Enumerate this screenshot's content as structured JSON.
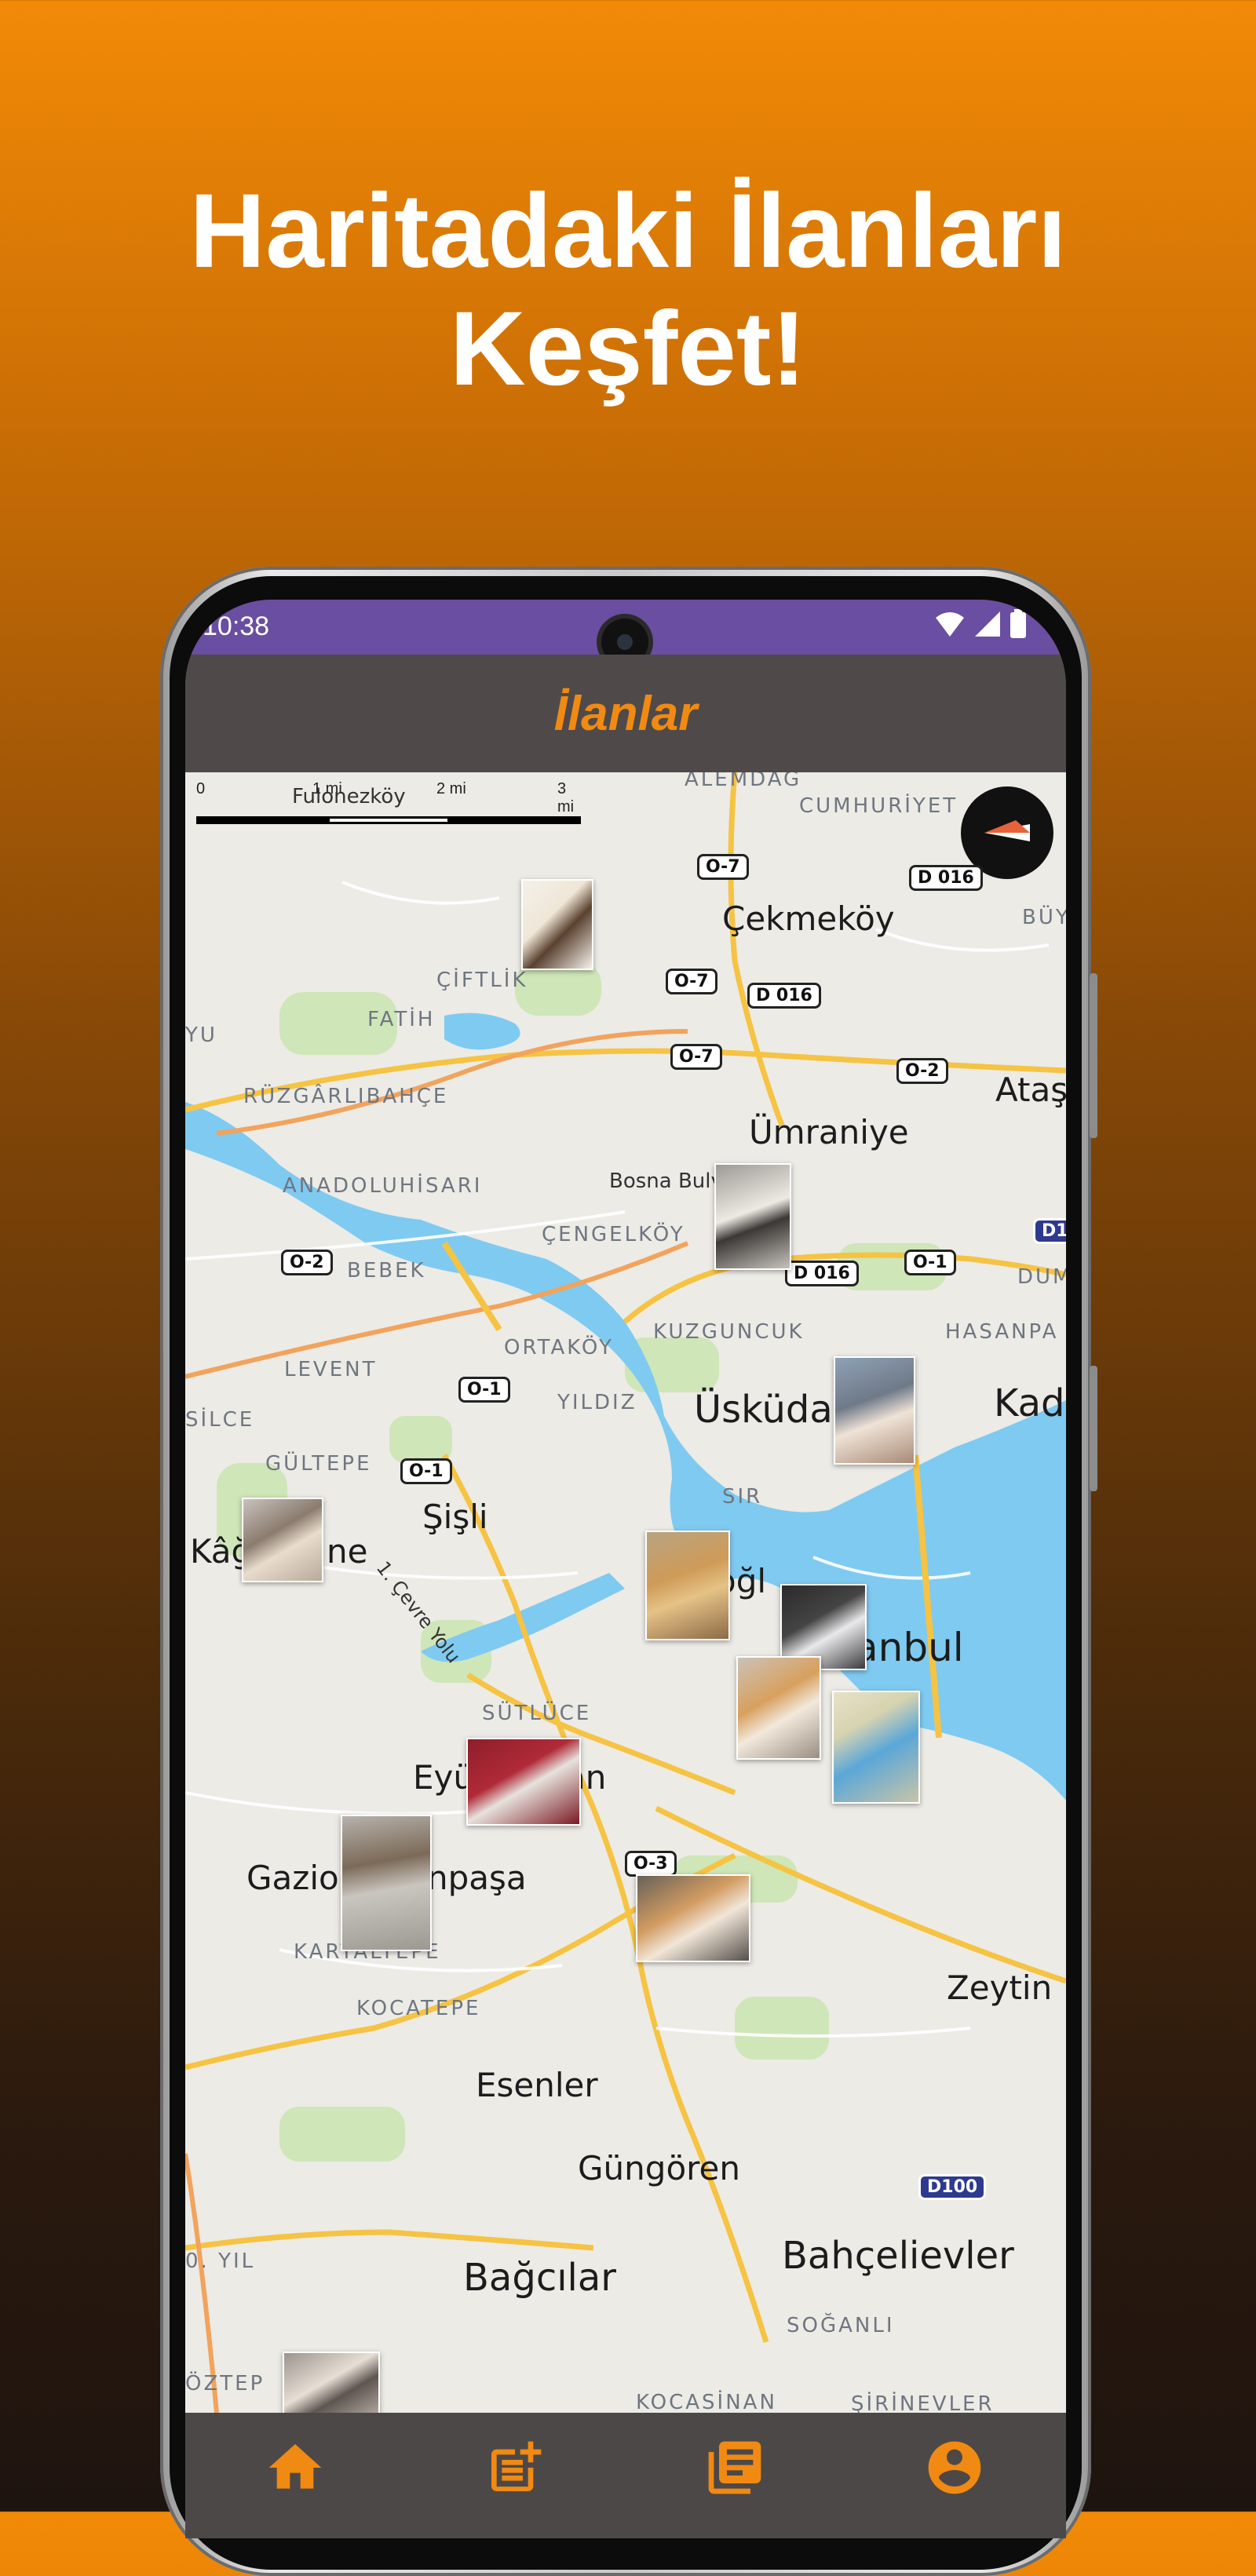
{
  "headline": {
    "line1": "Haritadaki İlanları",
    "line2": "Keşfet!"
  },
  "status_bar": {
    "time": "10:38",
    "icons": [
      "wifi-icon",
      "signal-icon",
      "battery-icon"
    ]
  },
  "app_bar": {
    "title": "İlanlar"
  },
  "map": {
    "scale": {
      "labels": [
        "0",
        "1 mi",
        "2 mi",
        "3 mi"
      ]
    },
    "compass_icon": "compass-icon",
    "places": [
      {
        "name": "Çekmeköy"
      },
      {
        "name": "Ümraniye"
      },
      {
        "name": "Ataş"
      },
      {
        "name": "Üsküda"
      },
      {
        "name": "Kad"
      },
      {
        "name": "Kâğ"
      },
      {
        "name": "ne"
      },
      {
        "name": "Şişli"
      },
      {
        "name": "oğl"
      },
      {
        "name": "anbul"
      },
      {
        "name": "Eyü"
      },
      {
        "name": "an"
      },
      {
        "name": "Gazio"
      },
      {
        "name": "npaşa"
      },
      {
        "name": "Zeytin"
      },
      {
        "name": "Esenler"
      },
      {
        "name": "Güngören"
      },
      {
        "name": "Bağcılar"
      },
      {
        "name": "Bahçelievler"
      }
    ],
    "districts": [
      {
        "name": "ALEMDAĞ"
      },
      {
        "name": "CUMHURİYET"
      },
      {
        "name": "BÜY"
      },
      {
        "name": "ÇİFTLİK"
      },
      {
        "name": "FATİH"
      },
      {
        "name": "RÜZGÂRLIBAHÇE"
      },
      {
        "name": "ANADOLUHİSARI"
      },
      {
        "name": "ÇENGELKÖY"
      },
      {
        "name": "BEBEK"
      },
      {
        "name": "DUMLU"
      },
      {
        "name": "ORTAKÖY"
      },
      {
        "name": "KUZGUNCUK"
      },
      {
        "name": "HASANPA"
      },
      {
        "name": "LEVENT"
      },
      {
        "name": "YILDIZ"
      },
      {
        "name": "SİLCE"
      },
      {
        "name": "GÜLTEPE"
      },
      {
        "name": "SÜTLÜCE"
      },
      {
        "name": "KARTALTEPE"
      },
      {
        "name": "KOCATEPE"
      },
      {
        "name": "SOĞANLI"
      },
      {
        "name": "ÖZTEP"
      },
      {
        "name": "KOCASİNAN"
      },
      {
        "name": "ŞİRİNEVLER"
      },
      {
        "name": "0. YIL"
      },
      {
        "name": "YU"
      },
      {
        "name": "Fulonezköy"
      },
      {
        "name": "SIR"
      }
    ],
    "streets": [
      {
        "name": "Bosna Bulv"
      },
      {
        "name": "1. Çevre Yolu"
      }
    ],
    "road_shields": [
      {
        "label": "O-7"
      },
      {
        "label": "D 016"
      },
      {
        "label": "O-7"
      },
      {
        "label": "D 016"
      },
      {
        "label": "O-7"
      },
      {
        "label": "O-2"
      },
      {
        "label": "O-2"
      },
      {
        "label": "D 016"
      },
      {
        "label": "O-1"
      },
      {
        "label": "D1"
      },
      {
        "label": "O-1"
      },
      {
        "label": "O-1"
      },
      {
        "label": "O-3"
      },
      {
        "label": "D100"
      }
    ]
  },
  "bottom_nav": {
    "items": [
      {
        "icon": "home-icon"
      },
      {
        "icon": "post-add-icon"
      },
      {
        "icon": "listings-icon"
      },
      {
        "icon": "account-icon"
      }
    ],
    "accent": "#f08a12"
  },
  "colors": {
    "status_bar": "#6a4ea1",
    "app_bar": "#4f4a49",
    "title": "#f08a12",
    "water": "#7fcaf1"
  }
}
